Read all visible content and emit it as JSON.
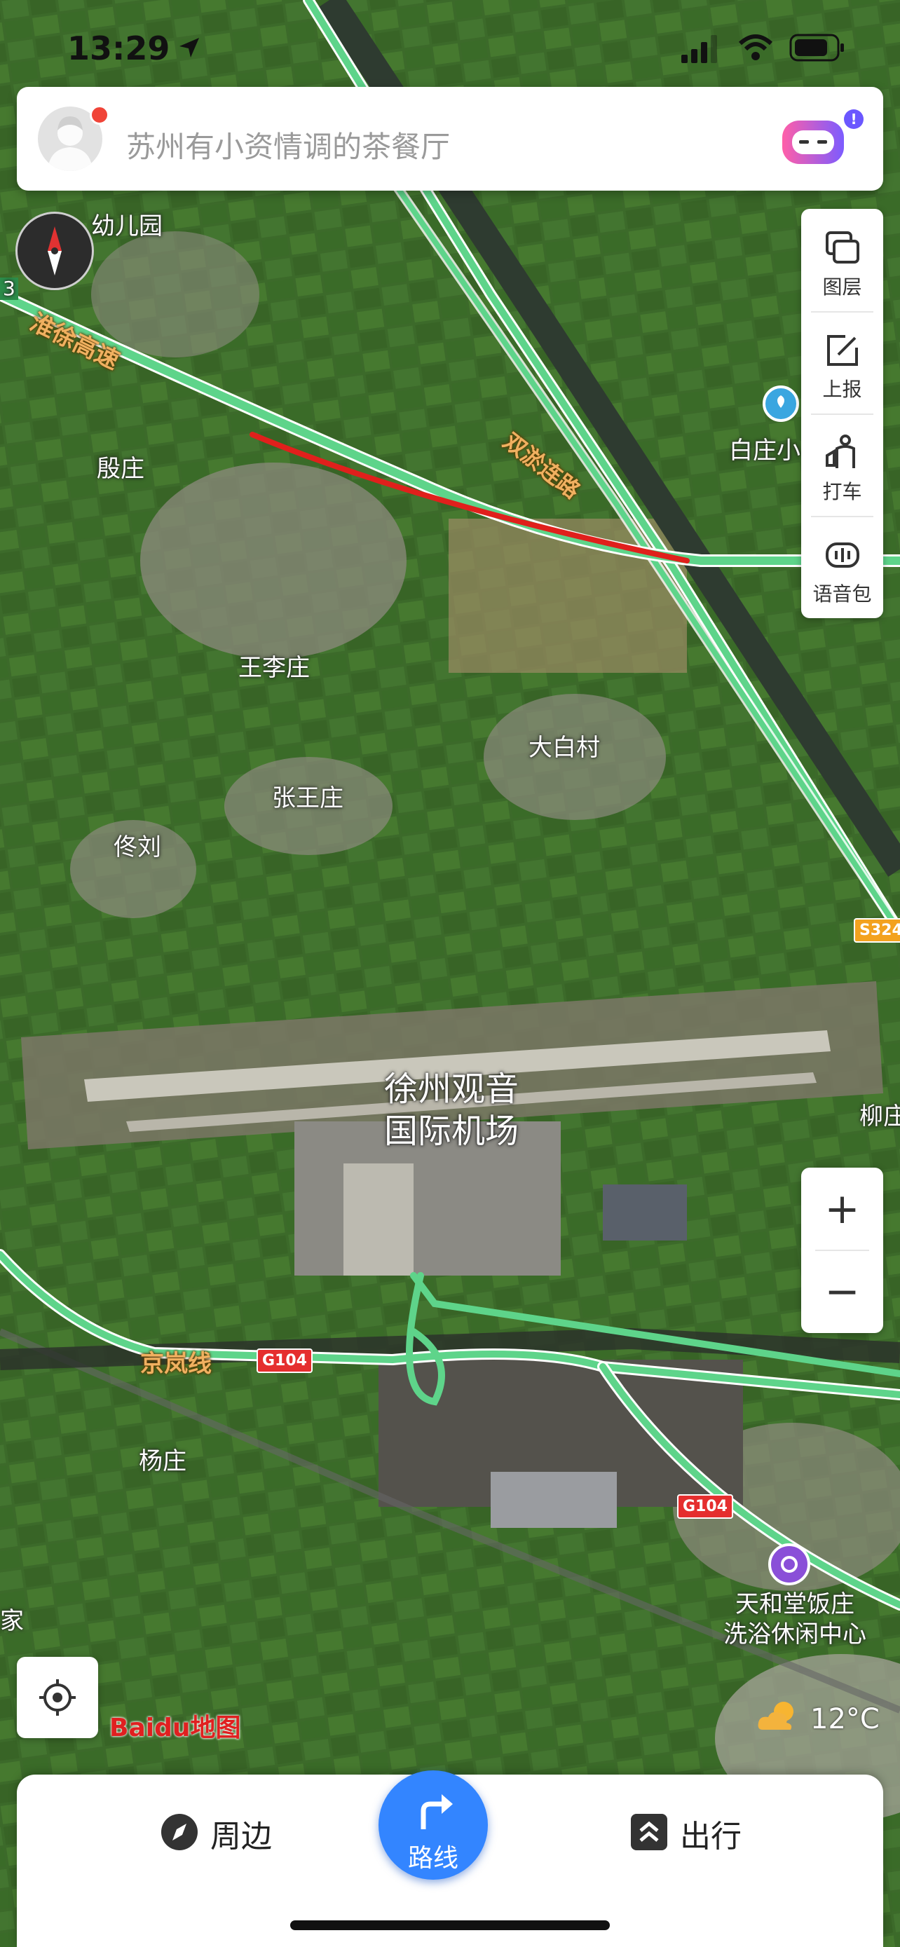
{
  "status_bar": {
    "time": "13:29"
  },
  "search": {
    "placeholder": "苏州有小资情调的茶餐厅"
  },
  "map_labels": {
    "kindergarten": "幼儿园",
    "huaixu_expressway": "淮徐高速",
    "yinzhuang": "殷庄",
    "wangli": "王李庄",
    "zhangwang": "张王庄",
    "dabai": "大白村",
    "tongliu": "佟刘",
    "baizhuang": "白庄小",
    "airport_line1": "徐州观音",
    "airport_line2": "国际机场",
    "liuzhuang": "柳庄",
    "jinglan": "京岚线",
    "yangzhuang": "杨庄",
    "poi_line1": "天和堂饭庄",
    "poi_line2": "洗浴休闲中心",
    "edge_left": "家",
    "edge_left_top": "3",
    "shuangzuo": "双淤连路"
  },
  "shields": {
    "g104_a": "G104",
    "g104_b": "G104",
    "s324": "S324"
  },
  "tools": [
    {
      "label": "图层",
      "icon": "layers-icon"
    },
    {
      "label": "上报",
      "icon": "report-icon"
    },
    {
      "label": "打车",
      "icon": "taxi-icon"
    },
    {
      "label": "语音包",
      "icon": "voice-pack-icon"
    }
  ],
  "zoom": {
    "in": "+",
    "out": "−"
  },
  "logo": {
    "text": "Baidu地图"
  },
  "weather": {
    "temp": "12°C"
  },
  "bottom_nav": {
    "nearby": "周边",
    "route": "路线",
    "travel": "出行"
  },
  "colors": {
    "accent": "#3385ff",
    "road_green": "#5ed48a",
    "road_red": "#e0201c"
  }
}
